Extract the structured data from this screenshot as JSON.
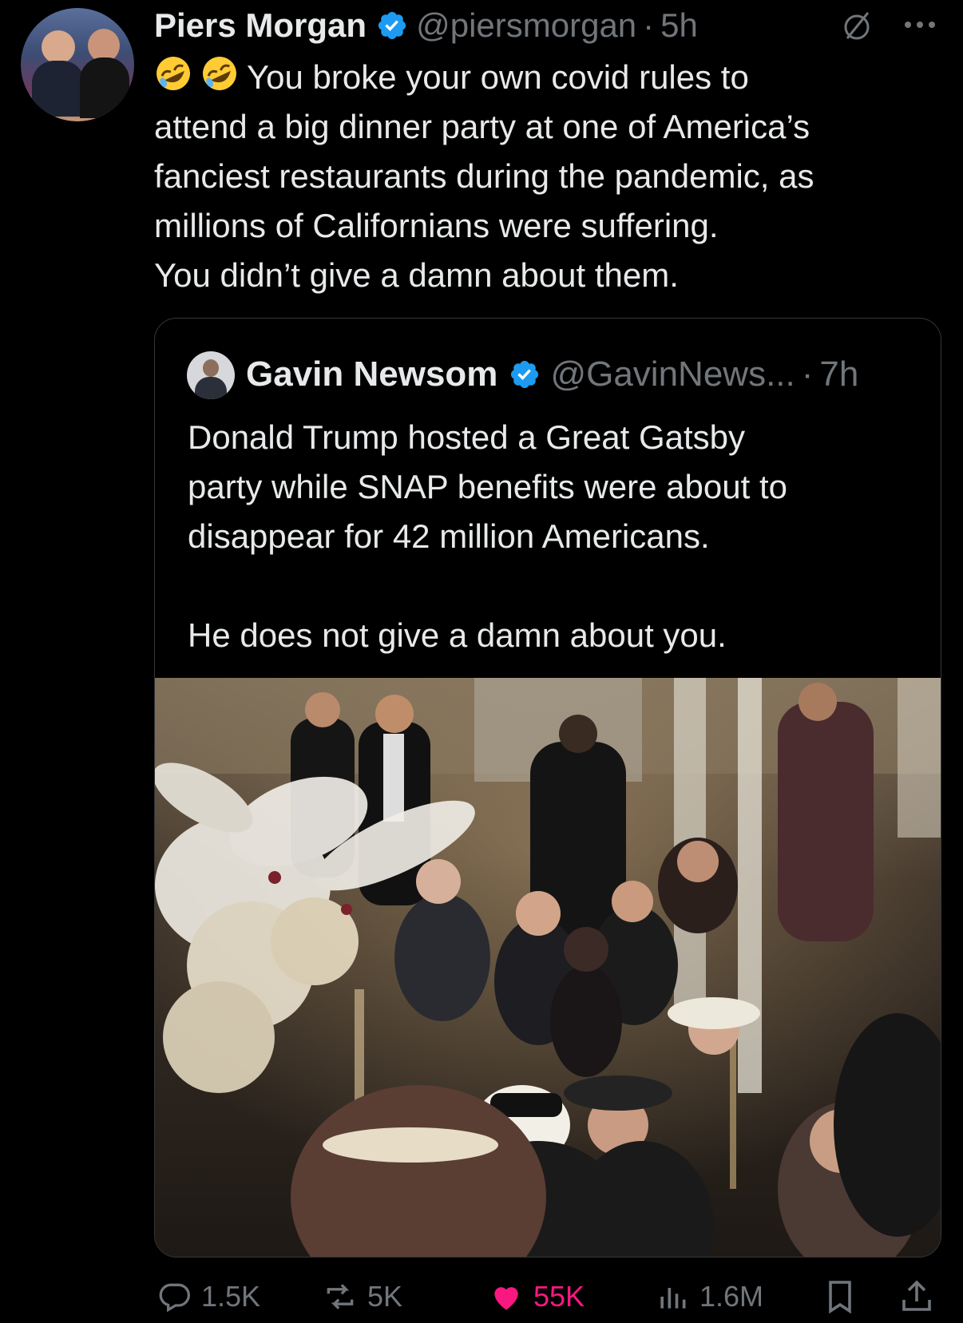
{
  "tweet": {
    "author_name": "Piers Morgan",
    "author_handle": "@piersmorgan",
    "separator": "·",
    "time": "5h",
    "text_lines": [
      "You broke your own covid rules to",
      "attend a big dinner party at one of America’s",
      "fanciest restaurants during the pandemic, as",
      "millions of Californians were suffering.",
      "You didn’t give a damn about them."
    ],
    "leading_emoji": "rolling-on-floor-laughing-emoji"
  },
  "quote": {
    "author_name": "Gavin Newsom",
    "author_handle": "@GavinNews...",
    "separator": "·",
    "time": "7h",
    "text_lines": [
      "Donald Trump hosted a Great Gatsby",
      "party while SNAP benefits were about to",
      "disappear for 42 million Americans."
    ],
    "text_line_final": "He does not give a damn about you.",
    "photo_icon": "party-photo"
  },
  "actions": {
    "replies": "1.5K",
    "reposts": "5K",
    "likes": "55K",
    "views": "1.6M"
  },
  "colors": {
    "background": "#000000",
    "text": "#e7e9ea",
    "muted": "#71767b",
    "verified": "#1d9bf0",
    "like": "#f91880",
    "border": "#333639"
  }
}
